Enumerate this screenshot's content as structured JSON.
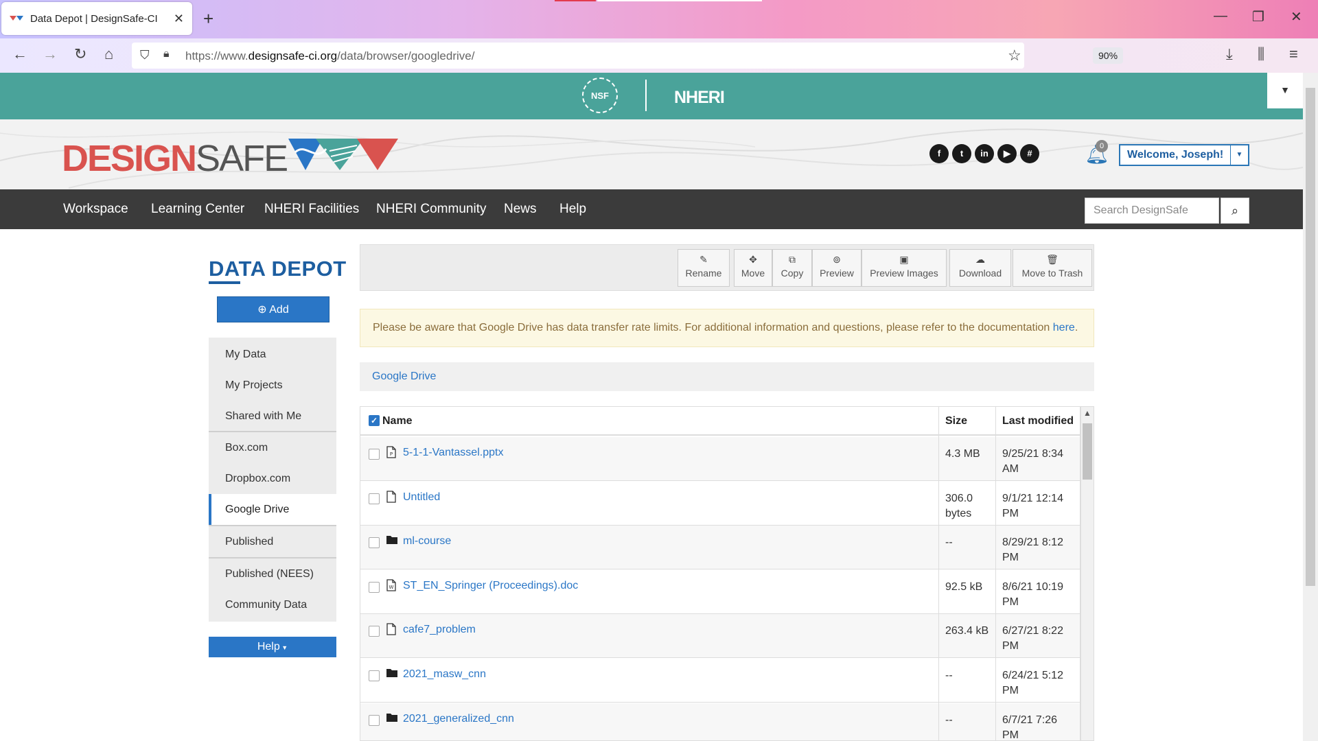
{
  "browser": {
    "tab_title": "Data Depot | DesignSafe-CI",
    "new_tab": "+",
    "url_prefix": "https://www.",
    "url_domain": "designsafe-ci.org",
    "url_path": "/data/browser/googledrive/",
    "zoom": "90%"
  },
  "nheri": {
    "nsf": "NSF",
    "text": "NHERI"
  },
  "header": {
    "logo_red": "DESIGN",
    "logo_gray": "SAFE",
    "notifications_count": "0",
    "welcome": "Welcome, Joseph!",
    "social": [
      "f",
      "t",
      "in",
      "▶",
      "#"
    ]
  },
  "nav": {
    "items": [
      "Workspace",
      "Learning Center",
      "NHERI Facilities",
      "NHERI Community",
      "News",
      "Help"
    ],
    "search_placeholder": "Search DesignSafe"
  },
  "sidebar": {
    "title": "DATA DEPOT",
    "add": "Add",
    "items": [
      "My Data",
      "My Projects",
      "Shared with Me",
      "Box.com",
      "Dropbox.com",
      "Google Drive",
      "Published",
      "Published (NEES)",
      "Community Data"
    ],
    "active_index": 5,
    "help": "Help"
  },
  "toolbar": {
    "buttons": [
      "Rename",
      "Move",
      "Copy",
      "Preview",
      "Preview Images",
      "Download",
      "Move to Trash"
    ]
  },
  "alert": {
    "text": "Please be aware that Google Drive has data transfer rate limits. For additional information and questions, please refer to the documentation ",
    "link": "here",
    "end": "."
  },
  "breadcrumb": "Google Drive",
  "table": {
    "headers": {
      "name": "Name",
      "size": "Size",
      "modified": "Last modified"
    },
    "rows": [
      {
        "name": "5-1-1-Vantassel.pptx",
        "type": "pptx",
        "size_line1": "4.3 MB",
        "size_line2": "",
        "mod_line1": "9/25/21 8:34",
        "mod_line2": "AM"
      },
      {
        "name": "Untitled",
        "type": "file",
        "size_line1": "306.0",
        "size_line2": "bytes",
        "mod_line1": "9/1/21 12:14",
        "mod_line2": "PM"
      },
      {
        "name": "ml-course",
        "type": "folder",
        "size_line1": "--",
        "size_line2": "",
        "mod_line1": "8/29/21 8:12",
        "mod_line2": "PM"
      },
      {
        "name": "ST_EN_Springer (Proceedings).doc",
        "type": "doc",
        "size_line1": "92.5 kB",
        "size_line2": "",
        "mod_line1": "8/6/21 10:19",
        "mod_line2": "PM"
      },
      {
        "name": "cafe7_problem",
        "type": "file",
        "size_line1": "263.4 kB",
        "size_line2": "",
        "mod_line1": "6/27/21 8:22",
        "mod_line2": "PM"
      },
      {
        "name": "2021_masw_cnn",
        "type": "folder",
        "size_line1": "--",
        "size_line2": "",
        "mod_line1": "6/24/21 5:12",
        "mod_line2": "PM"
      },
      {
        "name": "2021_generalized_cnn",
        "type": "folder",
        "size_line1": "--",
        "size_line2": "",
        "mod_line1": "6/7/21 7:26",
        "mod_line2": "PM"
      }
    ]
  },
  "colors": {
    "teal": "#4aa39a",
    "brand_blue": "#2a76c6",
    "brand_red": "#d9534f",
    "nav_dark": "#3b3b3b"
  }
}
